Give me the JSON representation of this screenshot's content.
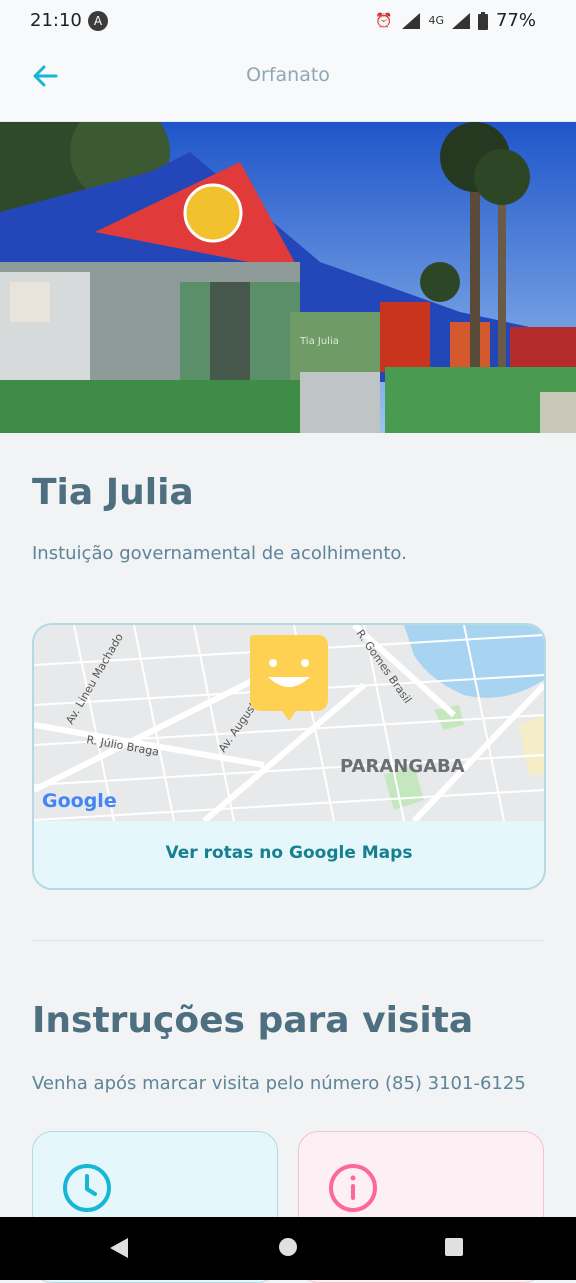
{
  "status_bar": {
    "time": "21:10",
    "indicator": "A",
    "network_label": "4G",
    "battery": "77%"
  },
  "app_bar": {
    "title": "Orfanato",
    "back_icon": "arrow-left-icon"
  },
  "hero": {
    "sign_text": "Tia Julia"
  },
  "orphanage": {
    "name": "Tia Julia",
    "description": "Instuição governamental de acolhimento."
  },
  "map": {
    "streets": [
      "Av. Lineu Machado",
      "R. Júlio Braga",
      "Av. Augusto",
      "R. Gomes Brasil"
    ],
    "district": "PARANGABA",
    "provider": "Google",
    "link_label": "Ver rotas no Google Maps",
    "marker_icon": "smiley-marker-icon"
  },
  "visit": {
    "title": "Instruções para visita",
    "instructions": "Venha após marcar visita pelo número (85) 3101-6125",
    "cards": [
      {
        "icon": "clock-icon",
        "color": "#15b6d6"
      },
      {
        "icon": "info-icon",
        "color": "#ff669d"
      }
    ]
  },
  "nav": {
    "back": "back-triangle-icon",
    "home": "home-circle-icon",
    "recents": "recents-square-icon"
  }
}
